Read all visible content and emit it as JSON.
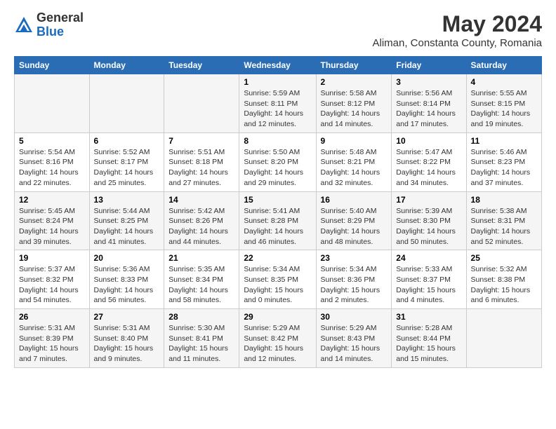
{
  "logo": {
    "general": "General",
    "blue": "Blue"
  },
  "title": "May 2024",
  "subtitle": "Aliman, Constanta County, Romania",
  "headers": [
    "Sunday",
    "Monday",
    "Tuesday",
    "Wednesday",
    "Thursday",
    "Friday",
    "Saturday"
  ],
  "weeks": [
    [
      {
        "day": "",
        "info": ""
      },
      {
        "day": "",
        "info": ""
      },
      {
        "day": "",
        "info": ""
      },
      {
        "day": "1",
        "info": "Sunrise: 5:59 AM\nSunset: 8:11 PM\nDaylight: 14 hours and 12 minutes."
      },
      {
        "day": "2",
        "info": "Sunrise: 5:58 AM\nSunset: 8:12 PM\nDaylight: 14 hours and 14 minutes."
      },
      {
        "day": "3",
        "info": "Sunrise: 5:56 AM\nSunset: 8:14 PM\nDaylight: 14 hours and 17 minutes."
      },
      {
        "day": "4",
        "info": "Sunrise: 5:55 AM\nSunset: 8:15 PM\nDaylight: 14 hours and 19 minutes."
      }
    ],
    [
      {
        "day": "5",
        "info": "Sunrise: 5:54 AM\nSunset: 8:16 PM\nDaylight: 14 hours and 22 minutes."
      },
      {
        "day": "6",
        "info": "Sunrise: 5:52 AM\nSunset: 8:17 PM\nDaylight: 14 hours and 25 minutes."
      },
      {
        "day": "7",
        "info": "Sunrise: 5:51 AM\nSunset: 8:18 PM\nDaylight: 14 hours and 27 minutes."
      },
      {
        "day": "8",
        "info": "Sunrise: 5:50 AM\nSunset: 8:20 PM\nDaylight: 14 hours and 29 minutes."
      },
      {
        "day": "9",
        "info": "Sunrise: 5:48 AM\nSunset: 8:21 PM\nDaylight: 14 hours and 32 minutes."
      },
      {
        "day": "10",
        "info": "Sunrise: 5:47 AM\nSunset: 8:22 PM\nDaylight: 14 hours and 34 minutes."
      },
      {
        "day": "11",
        "info": "Sunrise: 5:46 AM\nSunset: 8:23 PM\nDaylight: 14 hours and 37 minutes."
      }
    ],
    [
      {
        "day": "12",
        "info": "Sunrise: 5:45 AM\nSunset: 8:24 PM\nDaylight: 14 hours and 39 minutes."
      },
      {
        "day": "13",
        "info": "Sunrise: 5:44 AM\nSunset: 8:25 PM\nDaylight: 14 hours and 41 minutes."
      },
      {
        "day": "14",
        "info": "Sunrise: 5:42 AM\nSunset: 8:26 PM\nDaylight: 14 hours and 44 minutes."
      },
      {
        "day": "15",
        "info": "Sunrise: 5:41 AM\nSunset: 8:28 PM\nDaylight: 14 hours and 46 minutes."
      },
      {
        "day": "16",
        "info": "Sunrise: 5:40 AM\nSunset: 8:29 PM\nDaylight: 14 hours and 48 minutes."
      },
      {
        "day": "17",
        "info": "Sunrise: 5:39 AM\nSunset: 8:30 PM\nDaylight: 14 hours and 50 minutes."
      },
      {
        "day": "18",
        "info": "Sunrise: 5:38 AM\nSunset: 8:31 PM\nDaylight: 14 hours and 52 minutes."
      }
    ],
    [
      {
        "day": "19",
        "info": "Sunrise: 5:37 AM\nSunset: 8:32 PM\nDaylight: 14 hours and 54 minutes."
      },
      {
        "day": "20",
        "info": "Sunrise: 5:36 AM\nSunset: 8:33 PM\nDaylight: 14 hours and 56 minutes."
      },
      {
        "day": "21",
        "info": "Sunrise: 5:35 AM\nSunset: 8:34 PM\nDaylight: 14 hours and 58 minutes."
      },
      {
        "day": "22",
        "info": "Sunrise: 5:34 AM\nSunset: 8:35 PM\nDaylight: 15 hours and 0 minutes."
      },
      {
        "day": "23",
        "info": "Sunrise: 5:34 AM\nSunset: 8:36 PM\nDaylight: 15 hours and 2 minutes."
      },
      {
        "day": "24",
        "info": "Sunrise: 5:33 AM\nSunset: 8:37 PM\nDaylight: 15 hours and 4 minutes."
      },
      {
        "day": "25",
        "info": "Sunrise: 5:32 AM\nSunset: 8:38 PM\nDaylight: 15 hours and 6 minutes."
      }
    ],
    [
      {
        "day": "26",
        "info": "Sunrise: 5:31 AM\nSunset: 8:39 PM\nDaylight: 15 hours and 7 minutes."
      },
      {
        "day": "27",
        "info": "Sunrise: 5:31 AM\nSunset: 8:40 PM\nDaylight: 15 hours and 9 minutes."
      },
      {
        "day": "28",
        "info": "Sunrise: 5:30 AM\nSunset: 8:41 PM\nDaylight: 15 hours and 11 minutes."
      },
      {
        "day": "29",
        "info": "Sunrise: 5:29 AM\nSunset: 8:42 PM\nDaylight: 15 hours and 12 minutes."
      },
      {
        "day": "30",
        "info": "Sunrise: 5:29 AM\nSunset: 8:43 PM\nDaylight: 15 hours and 14 minutes."
      },
      {
        "day": "31",
        "info": "Sunrise: 5:28 AM\nSunset: 8:44 PM\nDaylight: 15 hours and 15 minutes."
      },
      {
        "day": "",
        "info": ""
      }
    ]
  ]
}
